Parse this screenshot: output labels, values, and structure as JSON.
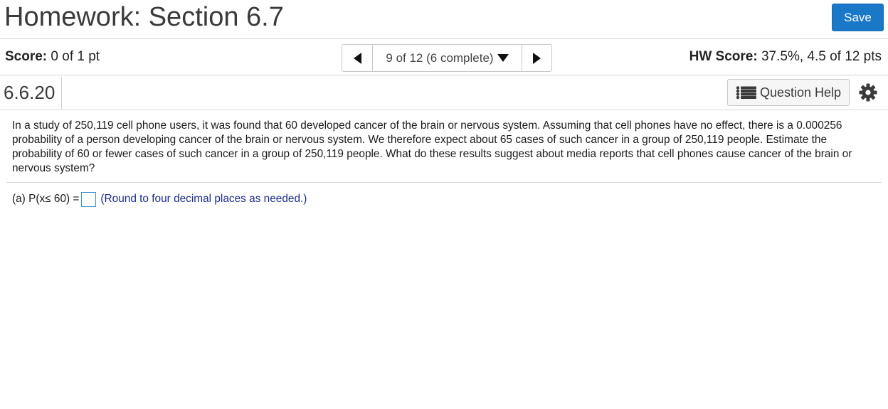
{
  "header": {
    "title": "Homework: Section 6.7",
    "save_label": "Save"
  },
  "scorebar": {
    "score_label": "Score:",
    "score_value": "0 of 1 pt",
    "nav_label": "9 of 12 (6 complete)",
    "hw_label": "HW Score:",
    "hw_value": "37.5%, 4.5 of 12 pts"
  },
  "question": {
    "number": "6.6.20",
    "help_label": "Question Help",
    "text": "In a study of 250,119 cell phone users, it was found that 60 developed cancer of the brain or nervous system. Assuming that cell phones have no effect, there is a 0.000256 probability of a person developing cancer of the brain or nervous system. We therefore expect about 65 cases of such cancer in a group of 250,119 people. Estimate the probability of 60 or fewer cases of such cancer in a group of 250,119 people. What do these results suggest about media reports that cell phones cause cancer of the brain or nervous system?",
    "part_a_prefix": "(a) P(x≤ 60) =",
    "part_a_value": "",
    "part_a_hint": "(Round to four decimal places as needed.)"
  },
  "icons": {
    "prev": "triangle-left-icon",
    "next": "triangle-right-icon",
    "dropdown": "triangle-down-icon",
    "help": "list-icon",
    "settings": "gear-icon"
  },
  "colors": {
    "save_bg": "#1a78c8",
    "hint_text": "#1c2b8a",
    "answer_border": "#3a8fd6"
  }
}
